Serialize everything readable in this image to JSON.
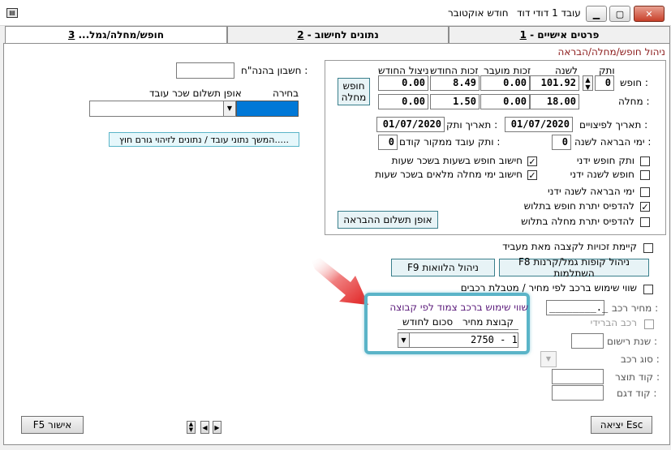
{
  "window": {
    "title": "עובד 1 דודי דוד",
    "month": "חודש אוקטובר"
  },
  "tabs": [
    {
      "label": "פרטים אישיים - ",
      "num": "1"
    },
    {
      "label": "נתונים לחישוב - ",
      "num": "2"
    },
    {
      "label": "חופש/מחלה/גמל... ",
      "num": "3"
    }
  ],
  "section_title": "ניהול חופש/מחלה/הבראה",
  "vacation": {
    "col_headers": {
      "vatek": "ותק",
      "yearly": "לשנה",
      "carried": "זכות מועבר",
      "monthly_right": "זכות החודש",
      "used": "ניצול החודש"
    },
    "vacation_label": "חופש :",
    "sick_label": "מחלה :",
    "vacation": {
      "vatek": "0",
      "yearly": "101.92",
      "carried": "0.00",
      "monthly_right": "8.49",
      "used": "0.00"
    },
    "sick": {
      "yearly": "18.00",
      "carried": "0.00",
      "monthly_right": "1.50",
      "used": "0.00"
    },
    "vacation_sick_button": "חופש מחלה"
  },
  "dates": {
    "severance_date_label": "תאריך לפיצויים :",
    "severance_date": "01/07/2020",
    "seniority_date_label": "תאריך ותק :",
    "seniority_date": "01/07/2020",
    "recovery_days_label": "ימי הבראה לשנה :",
    "recovery_days": "0",
    "prev_seniority_label": "ותק עובד ממקור קודם :",
    "prev_seniority": "0"
  },
  "checkboxes_right": [
    {
      "label": "ותק חופש ידני",
      "checked": false
    },
    {
      "label": "חופש לשנה ידני",
      "checked": false
    },
    {
      "label": "ימי הבראה לשנה ידני",
      "checked": false
    },
    {
      "label": "להדפיס יתרת חופש בתלוש",
      "checked": true
    },
    {
      "label": "להדפיס יתרת מחלה בתלוש",
      "checked": false
    }
  ],
  "checkboxes_left": [
    {
      "label": "חישוב חופש בשעות בשכר שעות",
      "checked": true
    },
    {
      "label": "חישוב ימי מחלה מלאים בשכר שעות",
      "checked": true
    }
  ],
  "recovery_payment_button": "אופן תשלום ההבראה",
  "bank_account_label": "חשבון בהנה\"ח :",
  "bank_account_value": "",
  "choice_label": "בחירה",
  "payment_method_label": "אופן תשלום שכר עובד",
  "continue_link": "המשך נתוני עובד / נתונים לזיהוי גורם חוץ.....",
  "pension_rights_label": "קיימת זכויות לקצבה מאת מעביד",
  "f8_button": "F8 ניהול קופות גמל/קרנות השתלמות",
  "f9_button": "F9 ניהול הלוואות",
  "car": {
    "car_value_label": "שווי שימוש ברכב לפי מחיר / מטבלת רכבים",
    "car_price_label": "מחיר רכב :",
    "car_price_value": "________._",
    "hybrid_label": "רכב הברידי",
    "reg_year_label": "שנת רישום :",
    "car_type_label": "סוג רכב :",
    "manufacturer_label": "קוד תוצר :",
    "model_label": "קוד דגם :"
  },
  "group_box": {
    "title": "שווי שימוש ברכב צמוד לפי קבוצה",
    "price_group_label": "קבוצת מחיר",
    "monthly_amount_label": "סכום לחודש",
    "selected_value": "2750 - 1"
  },
  "footer": {
    "exit_button": "יציאה Esc",
    "approve_button": "F5 אישור"
  },
  "colors": {
    "accent_teal": "#5ab4c8",
    "arrow_red": "#e02020",
    "title_red": "#8b1a1a",
    "selection_blue": "#0078d7"
  }
}
